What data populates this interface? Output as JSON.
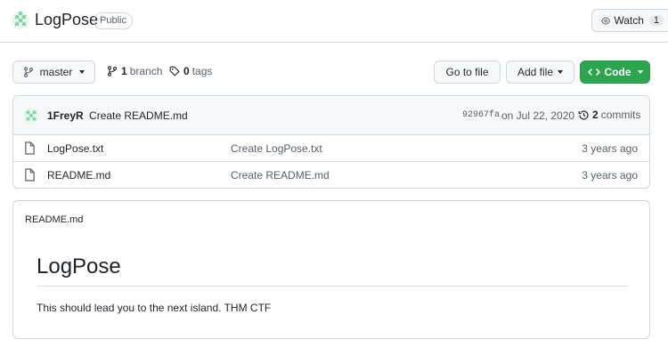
{
  "repo": {
    "name": "LogPose",
    "visibility": "Public",
    "watch_label": "Watch",
    "watch_count": "1"
  },
  "toolbar": {
    "branch": "master",
    "branch_count": "1",
    "branch_label": "branch",
    "tag_count": "0",
    "tag_label": "tags",
    "go_to_file": "Go to file",
    "add_file": "Add file",
    "code": "Code"
  },
  "commit": {
    "author": "1FreyR",
    "message": "Create README.md",
    "sha": "92967fa",
    "date": "on Jul 22, 2020",
    "count": "2",
    "count_label": "commits"
  },
  "files": [
    {
      "name": "LogPose.txt",
      "message": "Create LogPose.txt",
      "age": "3 years ago"
    },
    {
      "name": "README.md",
      "message": "Create README.md",
      "age": "3 years ago"
    }
  ],
  "readme": {
    "filename": "README.md",
    "heading": "LogPose",
    "body": "This should lead you to the next island. THM CTF"
  },
  "colors": {
    "primary_button": "#2da44e",
    "border": "#d0d7de",
    "avatar_green": "#7ed6a6"
  },
  "icons": [
    "repo-avatar-icon",
    "eye-icon",
    "branch-icon",
    "tag-icon",
    "history-icon",
    "file-icon",
    "chevron-code-icon"
  ]
}
